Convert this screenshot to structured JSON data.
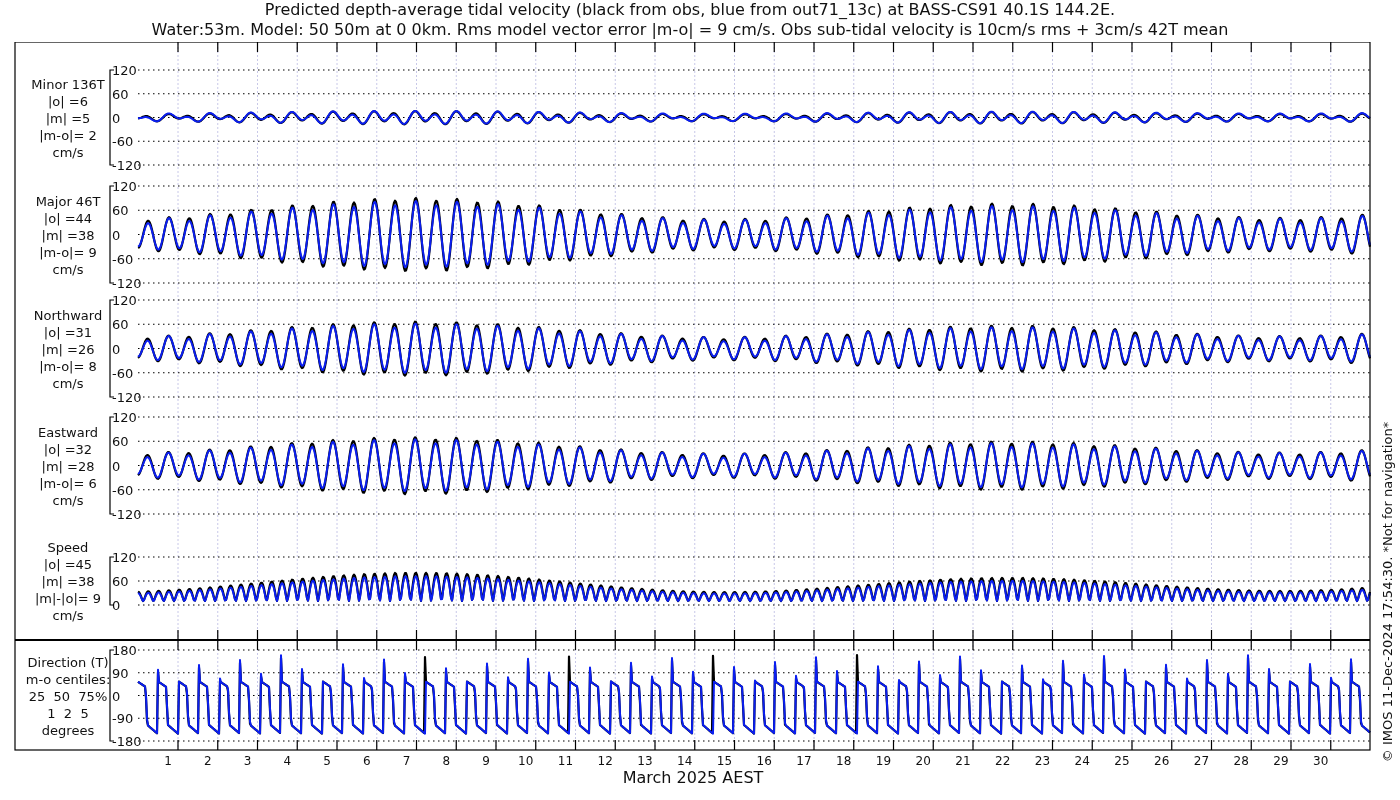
{
  "title_lines": [
    "Predicted depth-average tidal velocity (black from obs, blue from out71_13c) at BASS-CS91 40.1S 144.2E.",
    "Water:53m. Model: 50 50m at 0 0km. Rms model vector error |m-o| = 9 cm/s. Obs sub-tidal velocity is 10cm/s rms + 3cm/s 42T mean"
  ],
  "panels": [
    {
      "kind": "velocity",
      "label_lines": [
        "Minor 136T",
        "|o| =6",
        "|m| =5",
        "|m-o|= 2",
        "cm/s"
      ],
      "yticks": [
        "120",
        "60",
        "0",
        "-60",
        "-120"
      ]
    },
    {
      "kind": "velocity",
      "label_lines": [
        "Major 46T",
        "|o| =44",
        "|m| =38",
        "|m-o|= 9",
        "cm/s"
      ],
      "yticks": [
        "120",
        "60",
        "0",
        "-60",
        "-120"
      ]
    },
    {
      "kind": "velocity",
      "label_lines": [
        "Northward",
        "|o| =31",
        "|m| =26",
        "|m-o|= 8",
        "cm/s"
      ],
      "yticks": [
        "120",
        "60",
        "0",
        "-60",
        "-120"
      ]
    },
    {
      "kind": "velocity",
      "label_lines": [
        "Eastward",
        "|o| =32",
        "|m| =28",
        "|m-o|= 6",
        "cm/s"
      ],
      "yticks": [
        "120",
        "60",
        "0",
        "-60",
        "-120"
      ]
    },
    {
      "kind": "speed",
      "label_lines": [
        "Speed",
        "|o| =45",
        "|m| =38",
        "|m|-|o|= 9",
        "cm/s"
      ],
      "yticks": [
        "120",
        "60",
        "0"
      ]
    },
    {
      "kind": "direction",
      "label_lines": [
        "Direction (T)",
        "m-o centiles:",
        "25  50  75%",
        "1  2  5",
        "degrees"
      ],
      "yticks": [
        "180",
        "90",
        "0",
        "-90",
        "-180"
      ]
    }
  ],
  "xtick_labels": [
    "1",
    "2",
    "3",
    "4",
    "5",
    "6",
    "7",
    "8",
    "9",
    "10",
    "11",
    "12",
    "13",
    "14",
    "15",
    "16",
    "17",
    "18",
    "19",
    "20",
    "21",
    "22",
    "23",
    "24",
    "25",
    "26",
    "27",
    "28",
    "29",
    "30"
  ],
  "xlabel": "March 2025 AEST",
  "copyright": "© IMOS 11-Dec-2024 17:54:30. *Not for navigation*"
}
